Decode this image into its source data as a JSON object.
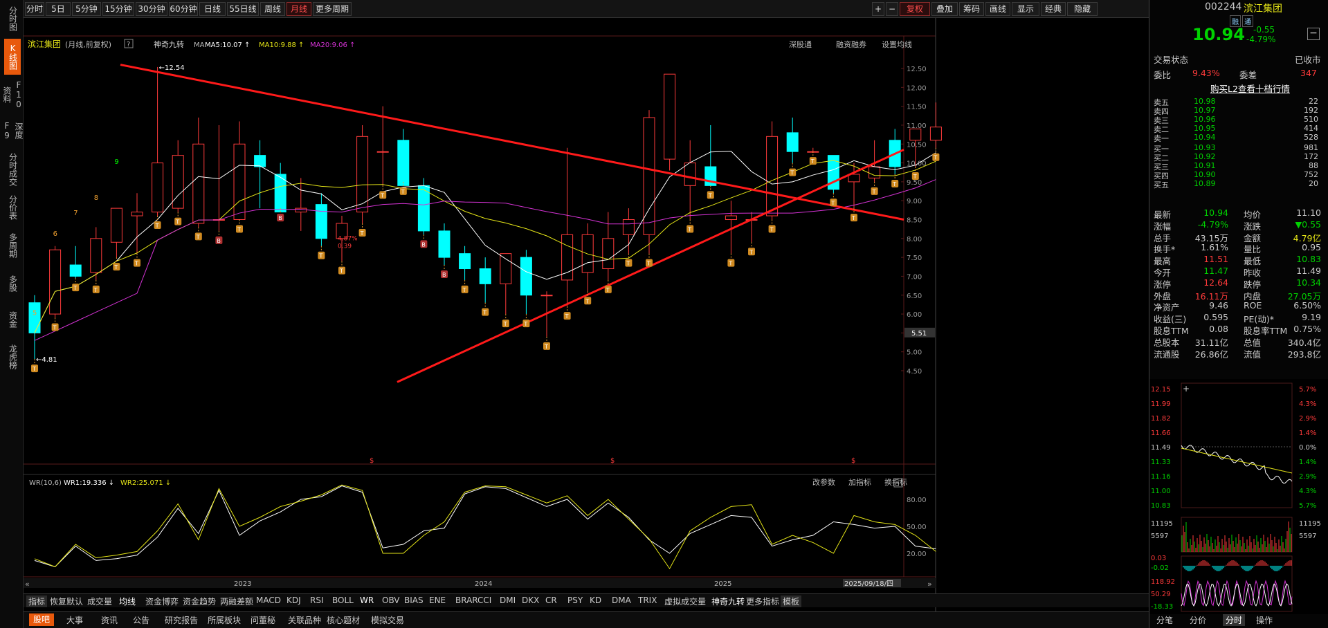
{
  "left_tabs": [
    "分时图",
    "K线图",
    "F10资料",
    "深度F9",
    "分时成交",
    "分价表",
    "多周期",
    "多股",
    "资金",
    "龙虎榜"
  ],
  "left_active": 1,
  "periods": [
    "分时",
    "5日",
    "5分钟",
    "15分钟",
    "30分钟",
    "60分钟",
    "日线",
    "55日线",
    "周线",
    "月线",
    "更多周期"
  ],
  "period_active": "月线",
  "right_tools": [
    "+",
    "−",
    "复权",
    "叠加",
    "筹码",
    "画线",
    "显示",
    "经典",
    "隐藏"
  ],
  "chart_header": {
    "name": "滨江集团",
    "desc": "(月线,前复权)",
    "indicator": "神奇九转",
    "ma_label": "MA",
    "ma5": "MA5:10.07",
    "ma10": "MA10:9.88",
    "ma20": "MA20:9.06",
    "links": [
      "深股通",
      "融资融券",
      "设置均线"
    ]
  },
  "price_axis": [
    "12.50",
    "12.00",
    "11.50",
    "11.00",
    "10.50",
    "10.00",
    "9.50",
    "9.00",
    "8.50",
    "8.00",
    "7.50",
    "7.00",
    "6.50",
    "6.00",
    "5.50",
    "5.00",
    "4.50"
  ],
  "price_marker": "5.51",
  "annotations": {
    "high": "12.54",
    "low": "4.81",
    "pct": "4.87%",
    "pct2": "0.39"
  },
  "nine_counts": [
    "5",
    "6",
    "7",
    "8",
    "9"
  ],
  "wr_header": {
    "name": "WR(10,6)",
    "wr1": "WR1:19.336",
    "wr2": "WR2:25.071",
    "tools": [
      "改参数",
      "加指标",
      "换指标"
    ]
  },
  "wr_axis": [
    "80.00",
    "50.00",
    "20.00"
  ],
  "time_axis": [
    "2023",
    "2024",
    "2025"
  ],
  "cursor_date": "2025/09/18/四",
  "indicator_tabs": [
    "指标",
    "恢复默认",
    "成交量",
    "均线",
    "资金博弈",
    "资金趋势",
    "两融差额",
    "MACD",
    "KDJ",
    "RSI",
    "BOLL",
    "WR",
    "OBV",
    "BIAS",
    "ENE",
    "BRAR",
    "CCI",
    "DMI",
    "DKX",
    "CR",
    "PSY",
    "KD",
    "DMA",
    "TRIX",
    "虚拟成交量",
    "神奇九转",
    "更多指标",
    "模板"
  ],
  "bottom_tabs": [
    "股吧",
    "大事",
    "资讯",
    "公告",
    "研究报告",
    "所属板块",
    "问董秘",
    "关联品种",
    "核心题材",
    "模拟交易"
  ],
  "stock": {
    "code": "002244",
    "name": "滨江集团",
    "tags": [
      "融",
      "通"
    ],
    "price": "10.94",
    "change": "-0.55",
    "change_pct": "-4.79%",
    "trade_status_label": "交易状态",
    "trade_status": "已收市",
    "wb_label": "委比",
    "wb": "9.43%",
    "wc_label": "委差",
    "wc": "347",
    "l2_link": "购买L2查看十档行情"
  },
  "asks": [
    {
      "label": "卖五",
      "price": "10.98",
      "vol": "22"
    },
    {
      "label": "卖四",
      "price": "10.97",
      "vol": "192"
    },
    {
      "label": "卖三",
      "price": "10.96",
      "vol": "510"
    },
    {
      "label": "卖二",
      "price": "10.95",
      "vol": "414"
    },
    {
      "label": "卖一",
      "price": "10.94",
      "vol": "528"
    }
  ],
  "bids": [
    {
      "label": "买一",
      "price": "10.93",
      "vol": "981"
    },
    {
      "label": "买二",
      "price": "10.92",
      "vol": "172"
    },
    {
      "label": "买三",
      "price": "10.91",
      "vol": "88"
    },
    {
      "label": "买四",
      "price": "10.90",
      "vol": "752"
    },
    {
      "label": "买五",
      "price": "10.89",
      "vol": "20"
    }
  ],
  "quote": [
    [
      "最新",
      "10.94",
      "均价",
      "11.10"
    ],
    [
      "涨幅",
      "-4.79%",
      "涨跌",
      "▼0.55"
    ],
    [
      "总手",
      "43.15万",
      "金额",
      "4.79亿"
    ],
    [
      "换手*",
      "1.61%",
      "量比",
      "0.95"
    ],
    [
      "最高",
      "11.51",
      "最低",
      "10.83"
    ],
    [
      "今开",
      "11.47",
      "昨收",
      "11.49"
    ],
    [
      "涨停",
      "12.64",
      "跌停",
      "10.34"
    ],
    [
      "外盘",
      "16.11万",
      "内盘",
      "27.05万"
    ],
    [
      "净资产",
      "9.46",
      "ROE",
      "6.50%"
    ],
    [
      "收益(三)",
      "0.595",
      "PE(动)*",
      "9.19"
    ],
    [
      "股息TTM",
      "0.08",
      "股息率TTM",
      "0.75%"
    ],
    [
      "总股本",
      "31.11亿",
      "总值",
      "340.4亿"
    ],
    [
      "流通股",
      "26.86亿",
      "流值",
      "293.8亿"
    ]
  ],
  "mini_axis_left": [
    "12.15",
    "11.99",
    "11.82",
    "11.66",
    "11.49",
    "11.33",
    "11.16",
    "11.00",
    "10.83"
  ],
  "mini_axis_right": [
    "5.7%",
    "4.3%",
    "2.9%",
    "1.4%",
    "0.0%",
    "1.4%",
    "2.9%",
    "4.3%",
    "5.7%"
  ],
  "mini_vol": {
    "left_top": "11195",
    "left_mid": "5597",
    "right_top": "11195",
    "right_mid": "5597"
  },
  "mini_ind": [
    "0.03",
    "-0.02",
    "118.92",
    "50.29",
    "-18.33"
  ],
  "right_bottom_tabs": [
    "分笔",
    "分价",
    "分时",
    "操作"
  ],
  "colors": {
    "up": "#ff3b3b",
    "down": "#00ffff",
    "ma5": "#ffffff",
    "ma10": "#e5e517",
    "ma20": "#d633d6",
    "trend": "#ff1a1a",
    "accent": "#e8590c"
  }
}
